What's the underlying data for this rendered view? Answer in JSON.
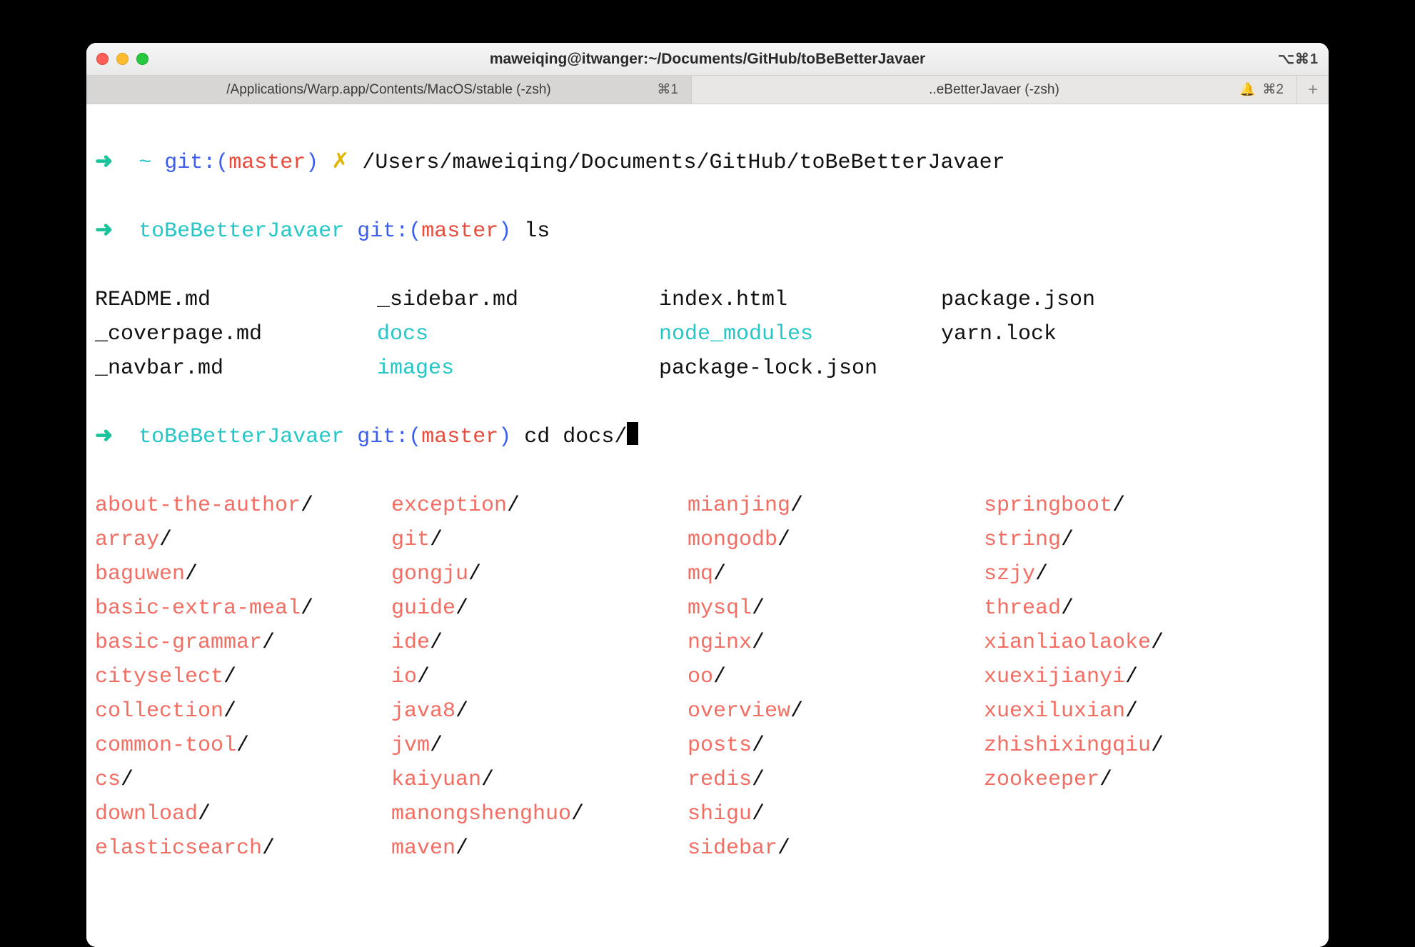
{
  "window": {
    "title": "maweiqing@itwanger:~/Documents/GitHub/toBeBetterJavaer",
    "right_indicator": "⌥⌘1"
  },
  "tabs": [
    {
      "label": "/Applications/Warp.app/Contents/MacOS/stable (-zsh)",
      "shortcut": "⌘1",
      "active": true
    },
    {
      "label": "..eBetterJavaer (-zsh)",
      "shortcut": "⌘2",
      "active": false
    }
  ],
  "prompt1": {
    "arrow": "➜",
    "dir": "~",
    "git_label": "git:(",
    "branch": "master",
    "git_close": ")",
    "dirty": "✗",
    "path": "/Users/maweiqing/Documents/GitHub/toBeBetterJavaer"
  },
  "prompt2": {
    "arrow": "➜",
    "dir": "toBeBetterJavaer",
    "git_label": "git:(",
    "branch": "master",
    "git_close": ")",
    "cmd": "ls"
  },
  "ls_output": {
    "rows": [
      [
        {
          "t": "README.md",
          "c": ""
        },
        {
          "t": "_sidebar.md",
          "c": ""
        },
        {
          "t": "index.html",
          "c": ""
        },
        {
          "t": "package.json",
          "c": ""
        }
      ],
      [
        {
          "t": "_coverpage.md",
          "c": ""
        },
        {
          "t": "docs",
          "c": "cyan"
        },
        {
          "t": "node_modules",
          "c": "cyan"
        },
        {
          "t": "yarn.lock",
          "c": ""
        }
      ],
      [
        {
          "t": "_navbar.md",
          "c": ""
        },
        {
          "t": "images",
          "c": "cyan"
        },
        {
          "t": "package-lock.json",
          "c": ""
        },
        {
          "t": "",
          "c": ""
        }
      ]
    ]
  },
  "prompt3": {
    "arrow": "➜",
    "dir": "toBeBetterJavaer",
    "git_label": "git:(",
    "branch": "master",
    "git_close": ")",
    "cmd": "cd docs/"
  },
  "completions": {
    "col1": [
      "about-the-author",
      "array",
      "baguwen",
      "basic-extra-meal",
      "basic-grammar",
      "cityselect",
      "collection",
      "common-tool",
      "cs",
      "download",
      "elasticsearch"
    ],
    "col2": [
      "exception",
      "git",
      "gongju",
      "guide",
      "ide",
      "io",
      "java8",
      "jvm",
      "kaiyuan",
      "manongshenghuo",
      "maven"
    ],
    "col3": [
      "mianjing",
      "mongodb",
      "mq",
      "mysql",
      "nginx",
      "oo",
      "overview",
      "posts",
      "redis",
      "shigu",
      "sidebar"
    ],
    "col4": [
      "springboot",
      "string",
      "szjy",
      "thread",
      "xianliaolaoke",
      "xuexijianyi",
      "xuexiluxian",
      "zhishixingqiu",
      "zookeeper"
    ]
  }
}
